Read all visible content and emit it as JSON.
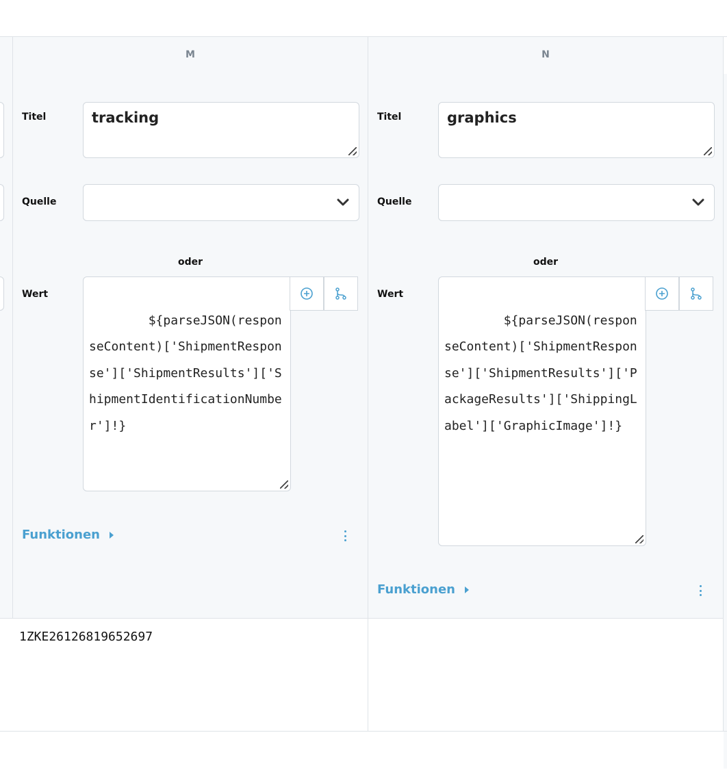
{
  "columns": [
    {
      "letter": "M",
      "title_label": "Titel",
      "title_value": "tracking",
      "source_label": "Quelle",
      "source_value": "",
      "or_label": "oder",
      "value_label": "Wert",
      "value_text": "${parseJSON(responseContent)['ShipmentResponse']['ShipmentResults']['ShipmentIdentificationNumber']!}",
      "functions_label": "Funktionen",
      "cell_value": "1ZKE26126819652697"
    },
    {
      "letter": "N",
      "title_label": "Titel",
      "title_value": "graphics",
      "source_label": "Quelle",
      "source_value": "",
      "or_label": "oder",
      "value_label": "Wert",
      "value_text": "${parseJSON(responseContent)['ShipmentResponse']['ShipmentResults']['PackageResults']['ShippingLabel']['GraphicImage']!}",
      "functions_label": "Funktionen",
      "cell_value": ""
    }
  ],
  "icons": {
    "add": "plus-circle-icon",
    "branch": "branch-icon",
    "dropdown": "chevron-down-icon",
    "more": "more-vertical-icon"
  },
  "colors": {
    "accent": "#4aa0d0",
    "panel_bg": "#f6f8fa",
    "border": "#d2d8de"
  }
}
